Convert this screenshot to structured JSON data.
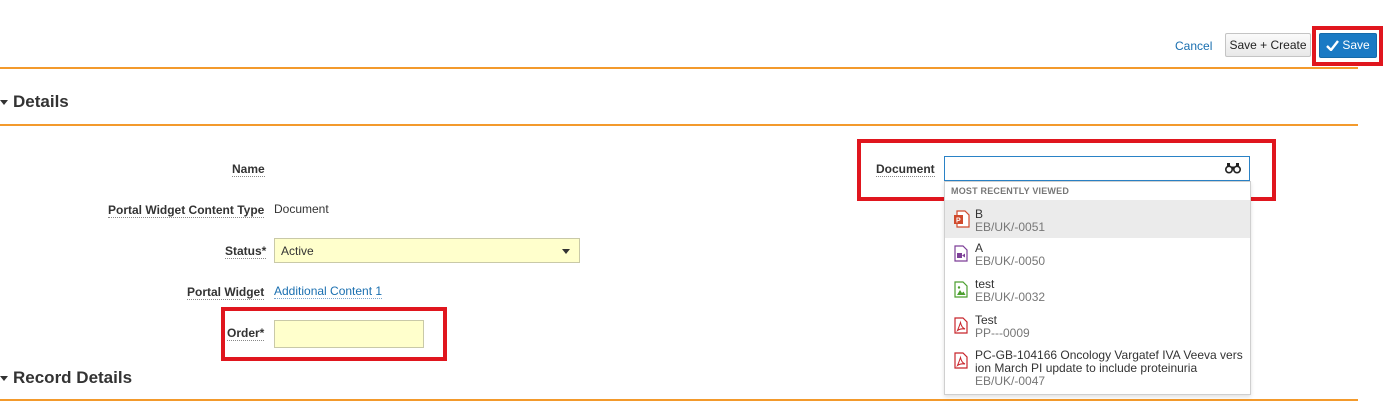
{
  "toolbar": {
    "cancel_label": "Cancel",
    "save_create_label": "Save + Create",
    "save_label": "Save"
  },
  "sections": {
    "details": "Details",
    "record_details": "Record Details"
  },
  "fields": {
    "name_label": "Name",
    "content_type_label": "Portal Widget Content Type",
    "content_type_value": "Document",
    "status_label": "Status*",
    "status_value": "Active",
    "portal_widget_label": "Portal Widget",
    "portal_widget_value": "Additional Content 1",
    "order_label": "Order*",
    "order_value": "",
    "document_label": "Document",
    "document_value": ""
  },
  "dropdown": {
    "header": "MOST RECENTLY VIEWED",
    "items": [
      {
        "title": "B",
        "id": "EB/UK/-0051",
        "icon": "powerpoint-icon",
        "color": "#d04a2c"
      },
      {
        "title": "A",
        "id": "EB/UK/-0050",
        "icon": "video-icon",
        "color": "#7d3f98"
      },
      {
        "title": "test",
        "id": "EB/UK/-0032",
        "icon": "image-icon",
        "color": "#4c9f2f"
      },
      {
        "title": "Test",
        "id": "PP---0009",
        "icon": "pdf-icon",
        "color": "#c8242b"
      },
      {
        "title": "PC-GB-104166 Oncology Vargatef IVA Veeva vers",
        "title2": "ion March PI update to include proteinuria",
        "id": "EB/UK/-0047",
        "icon": "pdf-icon",
        "color": "#c8242b"
      }
    ]
  },
  "colors": {
    "accent_orange": "#f39a2c",
    "primary_blue": "#1a7ac4",
    "highlight_red": "#e0161e",
    "required_yellow": "#ffffcc"
  }
}
